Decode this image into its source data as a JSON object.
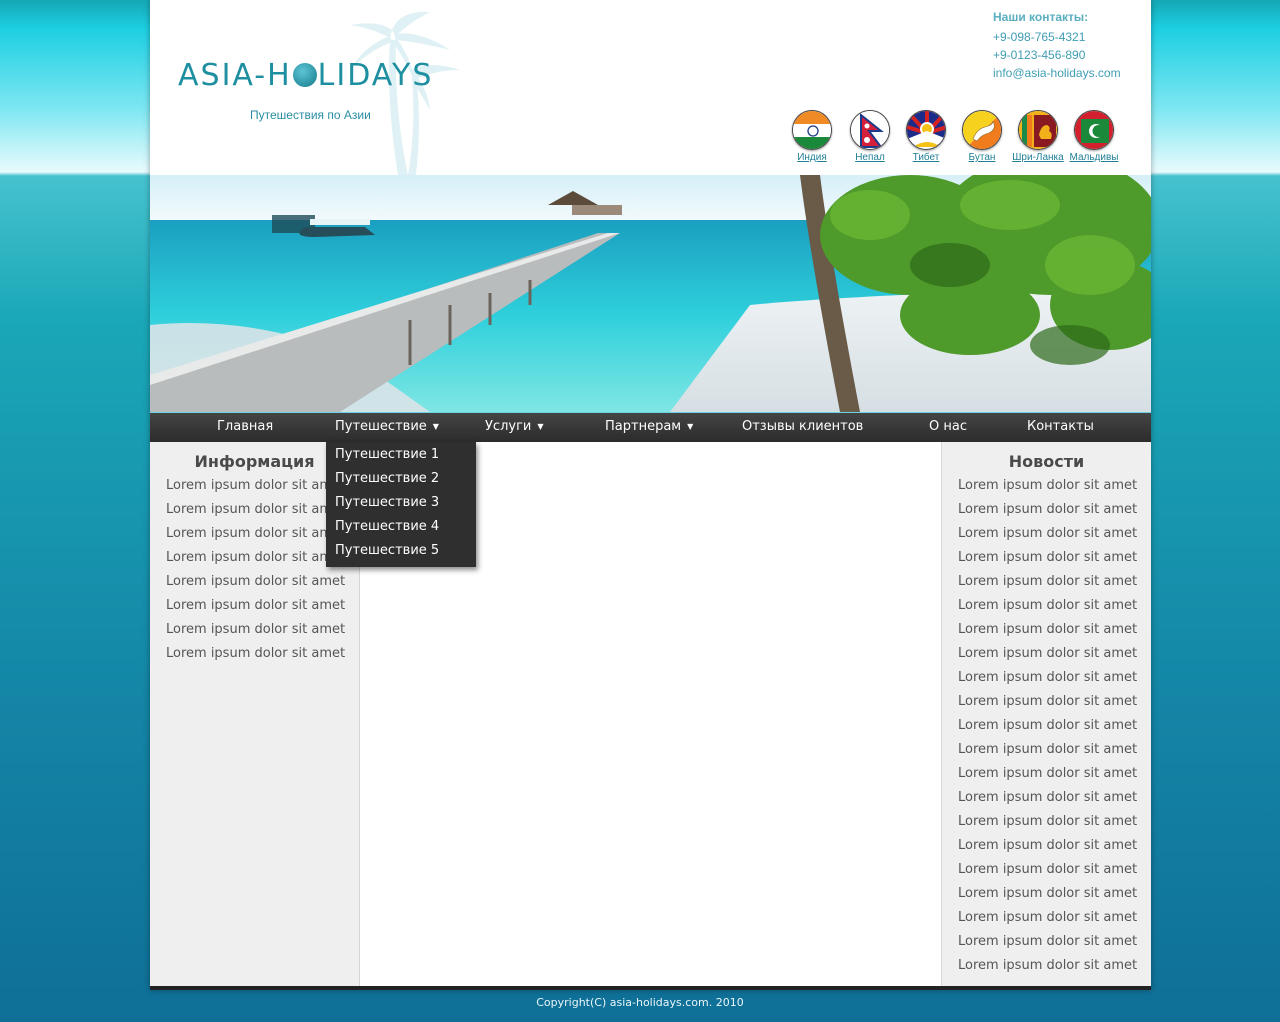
{
  "header": {
    "logo_text_1": "ASIA-H",
    "logo_text_2": "LIDAYS",
    "tagline": "Путешествия по Азии",
    "contacts_title": "Наши контакты:",
    "phone_1": "+9-098-765-4321",
    "phone_2": "+9-0123-456-890",
    "email": "info@asia-holidays.com"
  },
  "flags": [
    {
      "label": "Индия",
      "icon": "india-flag-icon"
    },
    {
      "label": "Непал",
      "icon": "nepal-flag-icon"
    },
    {
      "label": "Тибет",
      "icon": "tibet-flag-icon"
    },
    {
      "label": "Бутан",
      "icon": "bhutan-flag-icon"
    },
    {
      "label": "Шри-Ланка",
      "icon": "sri-lanka-flag-icon"
    },
    {
      "label": "Мальдивы",
      "icon": "maldives-flag-icon"
    }
  ],
  "nav": {
    "home": "Главная",
    "travel": "Путешествие",
    "services": "Услуги",
    "partners": "Партнерам",
    "reviews": "Отзывы клиентов",
    "about": "О нас",
    "contacts": "Контакты",
    "arrow": "▼"
  },
  "dropdown": [
    "Путешествие 1",
    "Путешествие 2",
    "Путешествие 3",
    "Путешествие 4",
    "Путешествие 5"
  ],
  "left": {
    "title": "Информация",
    "items": [
      "Lorem ipsum dolor sit amet",
      "Lorem ipsum dolor sit amet",
      "Lorem ipsum dolor sit amet",
      "Lorem ipsum dolor sit amet",
      "Lorem ipsum dolor sit amet",
      "Lorem ipsum dolor sit amet",
      "Lorem ipsum dolor sit amet",
      "Lorem ipsum dolor sit amet"
    ]
  },
  "right": {
    "title": "Новости",
    "items": [
      "Lorem ipsum dolor sit amet",
      "Lorem ipsum dolor sit amet",
      "Lorem ipsum dolor sit amet",
      "Lorem ipsum dolor sit amet",
      "Lorem ipsum dolor sit amet",
      "Lorem ipsum dolor sit amet",
      "Lorem ipsum dolor sit amet",
      "Lorem ipsum dolor sit amet",
      "Lorem ipsum dolor sit amet",
      "Lorem ipsum dolor sit amet",
      "Lorem ipsum dolor sit amet",
      "Lorem ipsum dolor sit amet",
      "Lorem ipsum dolor sit amet",
      "Lorem ipsum dolor sit amet",
      "Lorem ipsum dolor sit amet",
      "Lorem ipsum dolor sit amet",
      "Lorem ipsum dolor sit amet",
      "Lorem ipsum dolor sit amet",
      "Lorem ipsum dolor sit amet",
      "Lorem ipsum dolor sit amet",
      "Lorem ipsum dolor sit amet"
    ]
  },
  "footer": "Copyright(C) asia-holidays.com. 2010",
  "colors": {
    "accent": "#1d8fa0",
    "nav_bg": "#333333",
    "sidebar_bg": "#efefef"
  }
}
